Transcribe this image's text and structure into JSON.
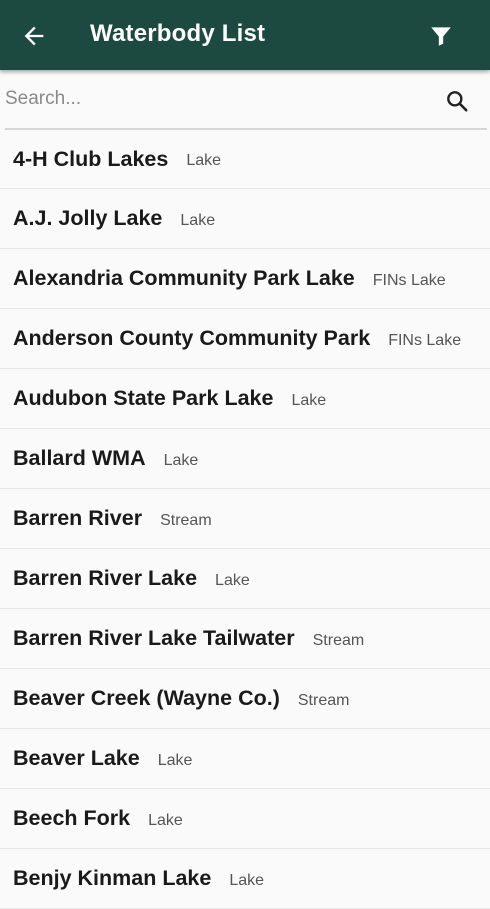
{
  "header": {
    "title": "Waterbody List",
    "back_icon": "arrow-left-icon",
    "filter_icon": "filter-icon",
    "bar_color": "#1d4a40"
  },
  "search": {
    "placeholder": "Search...",
    "value": "",
    "icon": "search-icon"
  },
  "waterbodies": [
    {
      "name": "4-H Club Lakes",
      "type": "Lake"
    },
    {
      "name": "A.J. Jolly Lake",
      "type": "Lake"
    },
    {
      "name": "Alexandria Community Park Lake",
      "type": "FINs Lake"
    },
    {
      "name": "Anderson County Community Park",
      "type": "FINs Lake"
    },
    {
      "name": "Audubon State Park Lake",
      "type": "Lake"
    },
    {
      "name": "Ballard WMA",
      "type": "Lake"
    },
    {
      "name": "Barren River",
      "type": "Stream"
    },
    {
      "name": "Barren River Lake",
      "type": "Lake"
    },
    {
      "name": "Barren River Lake Tailwater",
      "type": "Stream"
    },
    {
      "name": "Beaver Creek (Wayne Co.)",
      "type": "Stream"
    },
    {
      "name": "Beaver Lake",
      "type": "Lake"
    },
    {
      "name": "Beech Fork",
      "type": "Lake"
    },
    {
      "name": "Benjy Kinman Lake",
      "type": "Lake"
    }
  ]
}
